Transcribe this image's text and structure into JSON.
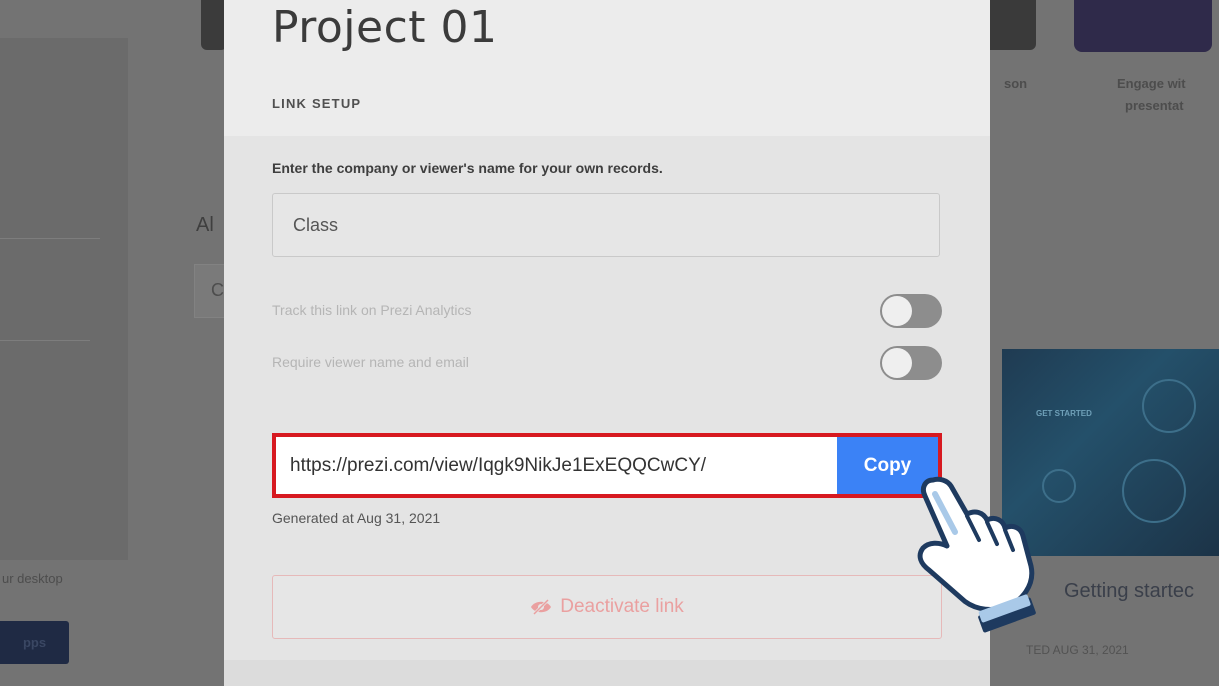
{
  "background": {
    "left_fragment_1": "Al",
    "left_fragment_2": "C",
    "desktop_text": "ur desktop",
    "apps_button": "pps",
    "right_fragment_top": "son",
    "engage_line_1": "Engage wit",
    "engage_line_2": "presentat",
    "card_title": "Getting startec",
    "card_meta": "TED AUG 31, 2021",
    "card_badge": "GET STARTED"
  },
  "modal": {
    "title": "Project 01",
    "section_label": "LINK SETUP",
    "instruction": "Enter the company or viewer's name for your own records.",
    "name_value": "Class",
    "toggles": [
      {
        "label": "Track this link on Prezi Analytics",
        "on": false
      },
      {
        "label": "Require viewer name and email",
        "on": false
      }
    ],
    "link_url": "https://prezi.com/view/Iqgk9NikJe1ExEQQCwCY/",
    "copy_label": "Copy",
    "generated_text": "Generated at Aug 31, 2021",
    "deactivate_label": "Deactivate link",
    "deactivate_icon": "eye-slash-icon"
  },
  "colors": {
    "highlight": "#d71920",
    "copy_button": "#3b82f6",
    "deactivate_text": "#eaa0a0",
    "overlay": "#737373"
  },
  "cursor_icon": "pointing-hand-icon"
}
